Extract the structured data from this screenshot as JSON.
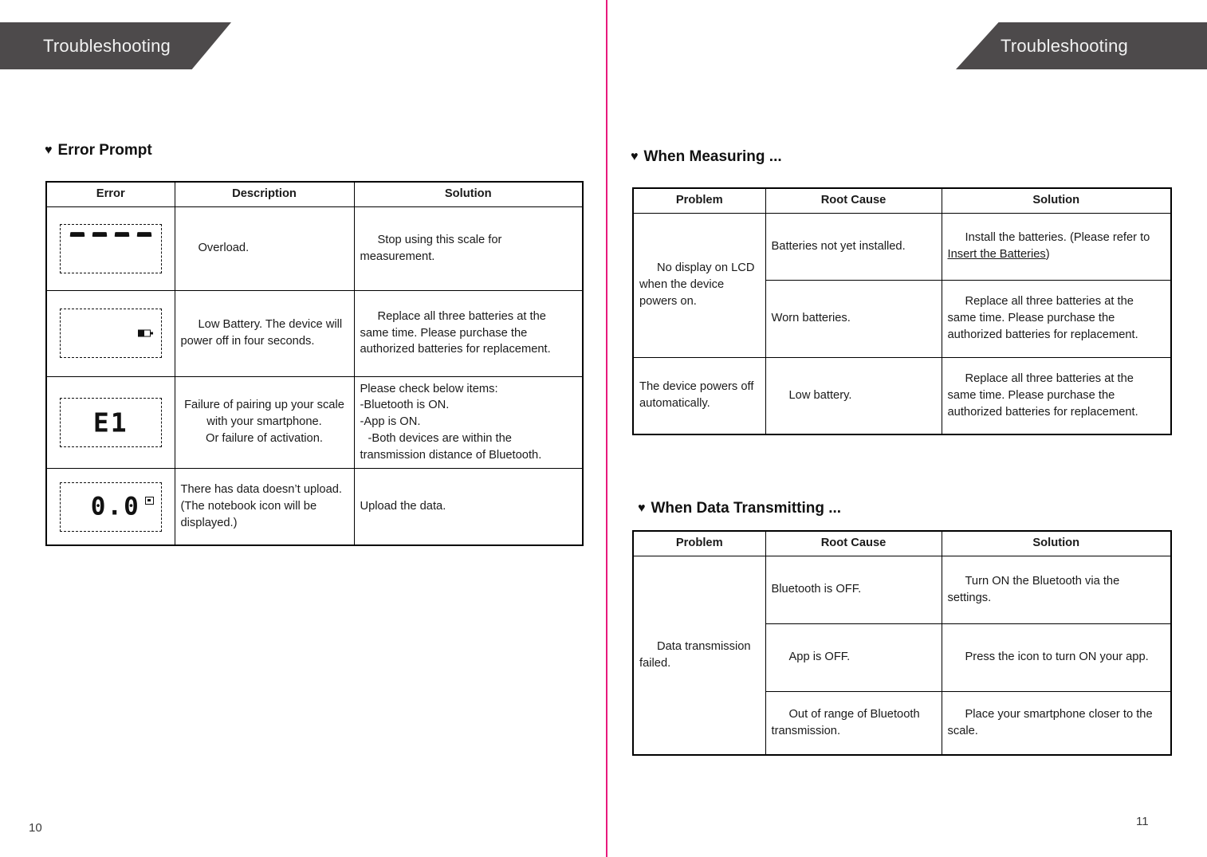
{
  "spread": {
    "gutter_color": "#e8197d",
    "tab_color": "#4d4a4b"
  },
  "left_page": {
    "tab_title": "Troubleshooting",
    "page_number": "10",
    "section": {
      "bullet": "♥",
      "title": "Error Prompt"
    },
    "table": {
      "headers": [
        "Error",
        "Description",
        "Solution"
      ],
      "rows": [
        {
          "icon": "lcd-overload-dashes",
          "description": "Overload.",
          "solution": "Stop using this scale for measurement."
        },
        {
          "icon": "lcd-low-battery",
          "description": "Low Battery. The device will power off in four seconds.",
          "solution": "Replace all three batteries at the same time. Please purchase the authorized batteries for replacement."
        },
        {
          "icon": "lcd-e1",
          "icon_text": "E1",
          "description_line1": "Failure of pairing up your scale with your smartphone.",
          "description_line2": "Or failure of activation.",
          "solution_line1": "Please check below items:",
          "solution_line2": "-Bluetooth is ON.",
          "solution_line3": "-App is ON.",
          "solution_line4": "-Both devices are within the transmission distance of Bluetooth."
        },
        {
          "icon": "lcd-zero-notebook",
          "icon_text": "0.0",
          "description": "There has data doesn’t upload. (The notebook icon will be displayed.)",
          "solution": "Upload the data."
        }
      ]
    }
  },
  "right_page": {
    "tab_title": "Troubleshooting",
    "page_number": "11",
    "section_measuring": {
      "bullet": "♥",
      "title": "When Measuring ..."
    },
    "table_measuring": {
      "headers": [
        "Problem",
        "Root Cause",
        "Solution"
      ],
      "problem_1": "No display on LCD when the device powers on.",
      "problem_2": "The device powers off automatically.",
      "rows": [
        {
          "root_cause": "Batteries not yet installed.",
          "solution_pre": "Install the batteries. (Please refer to ",
          "solution_link": "Insert the Batteries",
          "solution_post": ")"
        },
        {
          "root_cause": "Worn batteries.",
          "solution": "Replace all three batteries at the same time. Please purchase the authorized batteries for replacement."
        },
        {
          "root_cause": "Low battery.",
          "solution": "Replace all three batteries at the same time. Please purchase the authorized batteries for replacement."
        }
      ]
    },
    "section_transmitting": {
      "bullet": "♥",
      "title": "When Data Transmitting ..."
    },
    "table_transmitting": {
      "headers": [
        "Problem",
        "Root Cause",
        "Solution"
      ],
      "problem": "Data transmission failed.",
      "rows": [
        {
          "root_cause": "Bluetooth is OFF.",
          "solution": "Turn ON the Bluetooth via the settings."
        },
        {
          "root_cause": "App is OFF.",
          "solution": "Press the icon to turn ON your app."
        },
        {
          "root_cause": "Out of range of Bluetooth transmission.",
          "solution": "Place your smartphone closer to the scale."
        }
      ]
    }
  }
}
